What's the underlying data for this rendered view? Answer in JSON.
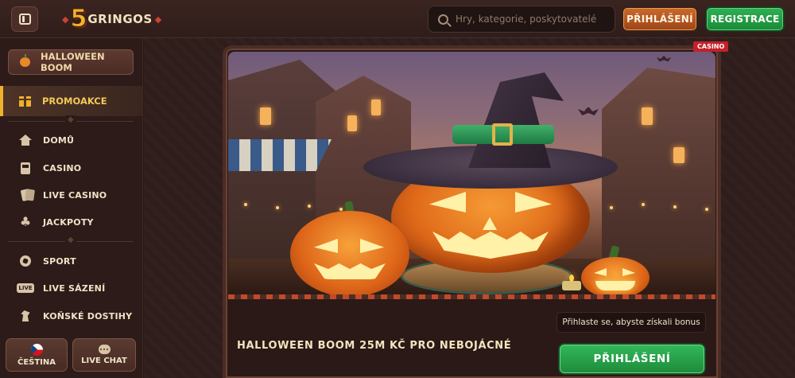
{
  "header": {
    "logo_number": "5",
    "logo_word": "GRINGOS",
    "search_placeholder": "Hry, kategorie, poskytovatelé",
    "login_label": "PŘIHLÁŠENÍ",
    "register_label": "REGISTRACE"
  },
  "sidebar": {
    "halloween_label": "HALLOWEEN BOOM",
    "promo_label": "PROMOAKCE",
    "group1": [
      {
        "label": "DOMŮ",
        "icon": "home-icon"
      },
      {
        "label": "CASINO",
        "icon": "slot-machine-icon"
      },
      {
        "label": "LIVE CASINO",
        "icon": "cards-icon"
      },
      {
        "label": "JACKPOTY",
        "icon": "clover-icon"
      }
    ],
    "group2": [
      {
        "label": "SPORT",
        "icon": "soccer-ball-icon"
      },
      {
        "label": "LIVE SÁZENÍ",
        "icon": "live-icon"
      },
      {
        "label": "KOŇSKÉ DOSTIHY",
        "icon": "horse-icon"
      }
    ],
    "language_label": "ČEŠTINA",
    "chat_label": "LIVE CHAT"
  },
  "banner": {
    "badge": "CASINO",
    "title": "HALLOWEEN BOOM 25M KČ PRO NEBOJÁCNÉ",
    "hint": "Přihlaste se, abyste získali bonus",
    "login_label": "PŘIHLÁŠENÍ"
  },
  "colors": {
    "accent_gold": "#f0b22a",
    "login_orange": "#c96a2d",
    "register_green": "#2fb054",
    "badge_red": "#c4202a",
    "background": "#2a1a18"
  }
}
